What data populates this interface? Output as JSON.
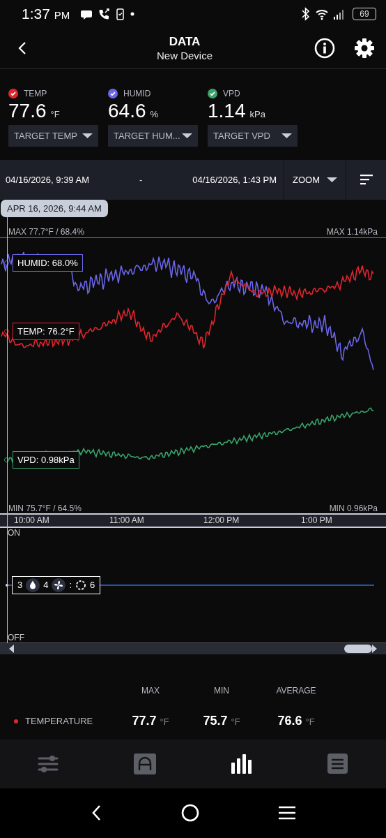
{
  "status_bar": {
    "time": "1:37",
    "time_suffix": "PM",
    "battery": "69"
  },
  "header": {
    "title": "DATA",
    "subtitle": "New Device"
  },
  "sensors": [
    {
      "label": "TEMP",
      "color": "#e0262e",
      "checked": true,
      "value": "77.6",
      "unit": "°F",
      "target": "TARGET TEMP"
    },
    {
      "label": "HUMID",
      "color": "#6b66e8",
      "checked": true,
      "value": "64.6",
      "unit": "%",
      "target": "TARGET HUM..."
    },
    {
      "label": "VPD",
      "color": "#3aa36a",
      "checked": true,
      "value": "1.14",
      "unit": "kPa",
      "target": "TARGET VPD"
    }
  ],
  "range": {
    "start": "04/16/2026, 9:39 AM",
    "separator": "-",
    "end": "04/16/2026, 1:43 PM",
    "zoom": "ZOOM"
  },
  "chart": {
    "cursor_time": "APR 16, 2026, 9:44 AM",
    "max_left": "MAX 77.7°F / 68.4%",
    "max_right": "MAX 1.14kPa",
    "min_left": "MIN 75.7°F / 64.5%",
    "min_right": "MIN 0.96kPa",
    "series": [
      {
        "kind": "humid",
        "label": "HUMID: 68.0%",
        "color": "#6b66e8"
      },
      {
        "kind": "temp",
        "label": "TEMP: 76.2°F",
        "color": "#e0262e"
      },
      {
        "kind": "vpd",
        "label": "VPD: 0.98kPa",
        "color": "#3aa36a"
      }
    ],
    "time_labels": [
      "10:00 AM",
      "11:00 AM",
      "12:00 PM",
      "1:00 PM"
    ],
    "on_label": "ON",
    "off_label": "OFF",
    "device_badge": [
      {
        "kind": "text",
        "text": "3"
      },
      {
        "kind": "drop"
      },
      {
        "kind": "text",
        "text": "4"
      },
      {
        "kind": "fan"
      },
      {
        "kind": "text",
        "text": ":"
      },
      {
        "kind": "ring"
      },
      {
        "kind": "text",
        "text": "6"
      }
    ]
  },
  "stats": {
    "columns": [
      "MAX",
      "MIN",
      "AVERAGE"
    ],
    "rows": [
      {
        "label": "TEMPERATURE",
        "color": "#e0262e",
        "values": [
          {
            "value": "77.7",
            "unit": "°F"
          },
          {
            "value": "75.7",
            "unit": "°F"
          },
          {
            "value": "76.6",
            "unit": "°F"
          }
        ]
      }
    ]
  },
  "bottom_nav": [
    {
      "kind": "sliders",
      "selected": false
    },
    {
      "kind": "arch",
      "selected": false
    },
    {
      "kind": "bars",
      "selected": true
    },
    {
      "kind": "list",
      "selected": false
    }
  ]
}
